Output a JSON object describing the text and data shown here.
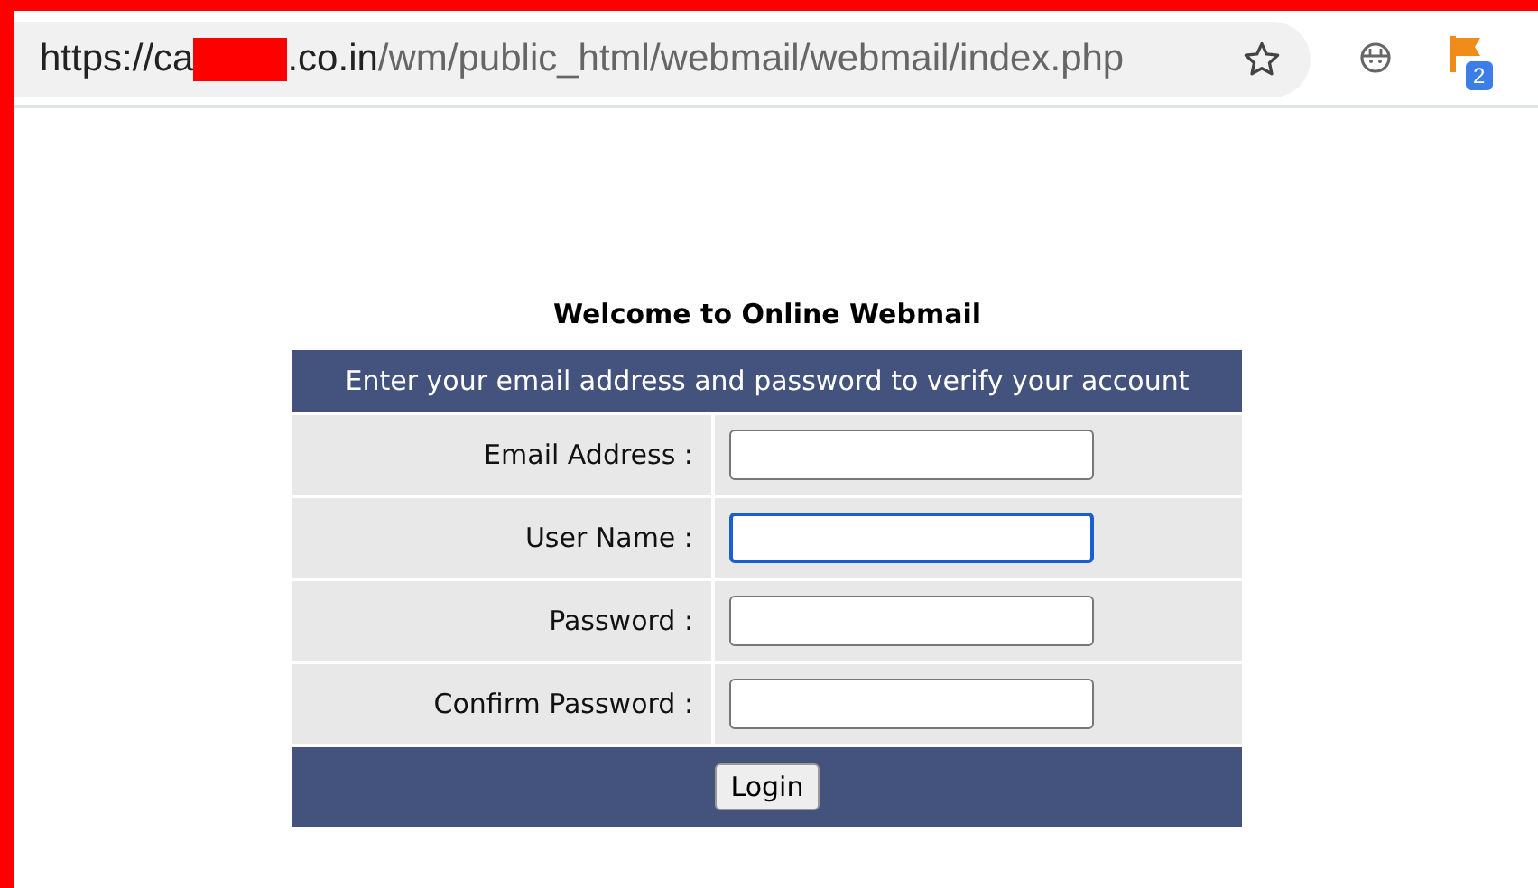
{
  "address_bar": {
    "url_start": "https://ca",
    "redacted": true,
    "url_host_end": ".co.in",
    "url_path": "/wm/public_html/webmail/webmail/index.php"
  },
  "extensions": {
    "badge": "2"
  },
  "page": {
    "heading": "Welcome to Online Webmail",
    "form": {
      "header": "Enter your email address and password to verify your account",
      "fields": [
        {
          "label": "Email Address :",
          "focused": false
        },
        {
          "label": "User Name :",
          "focused": true
        },
        {
          "label": "Password :",
          "focused": false
        },
        {
          "label": "Confirm Password :",
          "focused": false
        }
      ],
      "button": "Login"
    }
  }
}
